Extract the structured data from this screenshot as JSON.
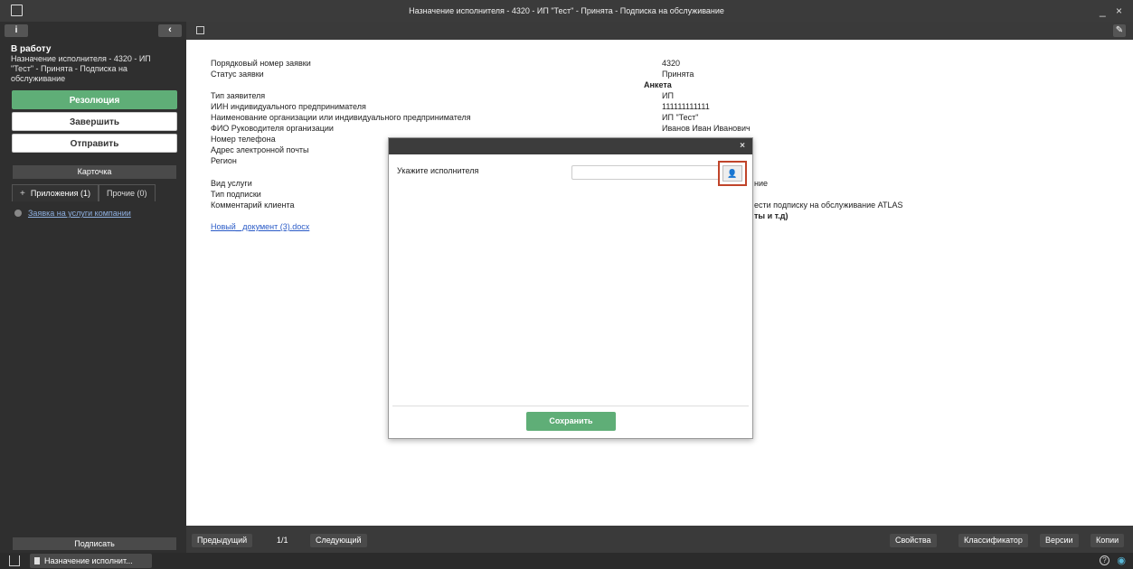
{
  "window": {
    "title": "Назначение исполнителя - 4320 - ИП \"Тест\" - Принята - Подписка на обслуживание",
    "controls": "_ ×"
  },
  "sidebar": {
    "info_label": "i",
    "collapse_label": "‹",
    "status_title": "В работу",
    "status_desc": "Назначение исполнителя - 4320 - ИП \"Тест\" - Принята - Подписка на обслуживание",
    "resolution_label": "Резолюция",
    "complete_label": "Завершить",
    "send_label": "Отправить",
    "card_label": "Карточка",
    "tabs": [
      {
        "label": "Приложения (1)"
      },
      {
        "label": "Прочие (0)"
      }
    ],
    "plus": "+",
    "attachments": [
      {
        "label": "Заявка на услуги компании"
      }
    ],
    "sign_label": "Подписать"
  },
  "document": {
    "fields": [
      {
        "label": "Порядковый номер заявки",
        "value": "4320"
      },
      {
        "label": "Статус заявки",
        "value": "Принята"
      },
      {
        "label": "Тип заявителя",
        "value": "ИП"
      },
      {
        "label": "ИИН индивидуального предпринимателя",
        "value": "111111111111"
      },
      {
        "label": "Наименование организации или индивидуального предпринимателя",
        "value": "ИП \"Тест\""
      },
      {
        "label": "ФИО Руководителя организации",
        "value": "Иванов Иван Иванович"
      },
      {
        "label": "Номер телефона",
        "value": ""
      },
      {
        "label": "Адрес электронной почты",
        "value": ""
      },
      {
        "label": "Регион",
        "value": ""
      },
      {
        "label": "Вид услуги",
        "value": "ние"
      },
      {
        "label": "Тип подписки",
        "value": ""
      },
      {
        "label": "Комментарий клиента",
        "value": "ести подписку на обслуживание ATLAS"
      }
    ],
    "section_header": "Анкета",
    "extra_bold": "ты и т.д)",
    "attachment_link": "Новый_ документ (3).docx"
  },
  "modal": {
    "close": "×",
    "label": "Укажите исполнителя",
    "input_value": "",
    "picker_icon": "user-picker-icon",
    "picker_glyph": "👤",
    "save_label": "Сохранить"
  },
  "pager": {
    "prev_label": "Предыдущий",
    "page": "1/1",
    "next_label": "Следующий",
    "properties_label": "Свойства",
    "classifier_label": "Классификатор",
    "versions_label": "Версии",
    "copies_label": "Копии"
  },
  "taskbar": {
    "task_label": "Назначение исполнит...",
    "help": "?",
    "wifi": "◉"
  },
  "colors": {
    "accent_green": "#5fae77",
    "highlight_red": "#c0442a",
    "link_blue": "#2a5bc7"
  }
}
